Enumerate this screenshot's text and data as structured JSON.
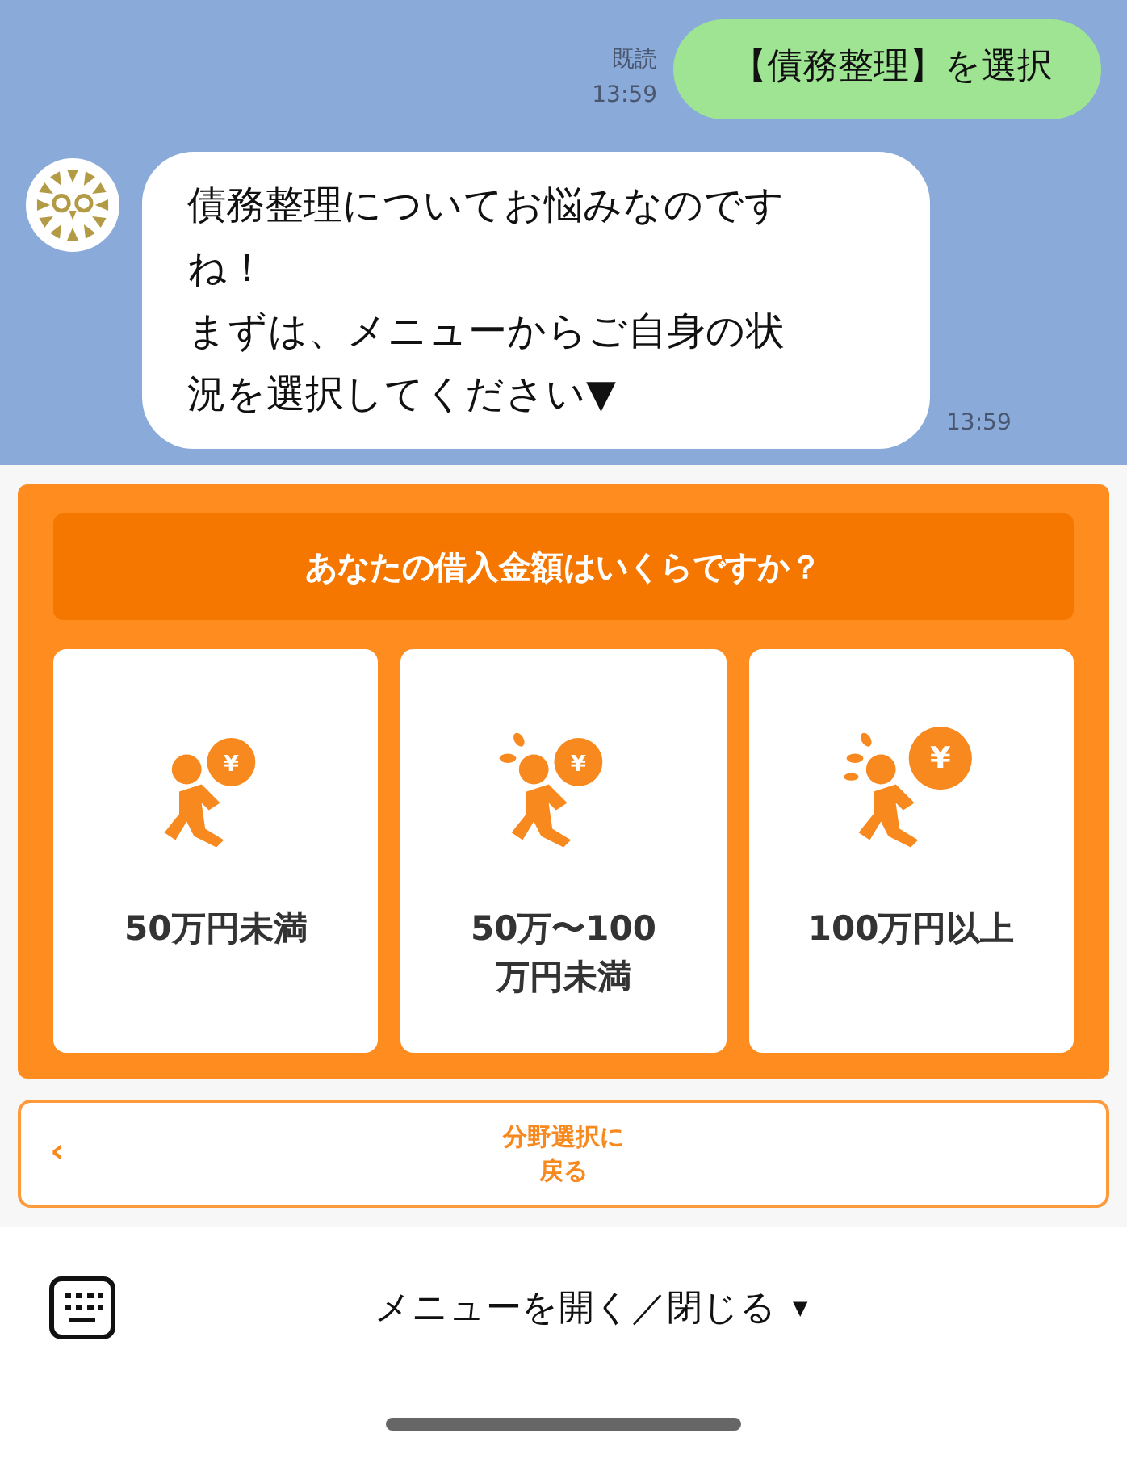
{
  "chat": {
    "messages": [
      {
        "kind": "outgoing",
        "text": "【債務整理】を選択",
        "read_label": "既読",
        "time": "13:59"
      },
      {
        "kind": "incoming",
        "paragraphs": [
          "債務整理についてお悩みなのですね！",
          "まずは、メニューからご自身の状況を選択してください▼"
        ],
        "time": "13:59"
      }
    ]
  },
  "rich_menu": {
    "question": "あなたの借入金額はいくらですか？",
    "options": [
      {
        "coin_symbol": "¥",
        "label": "50万円未満"
      },
      {
        "coin_symbol": "¥",
        "label": "50万〜100万円未満"
      },
      {
        "coin_symbol": "¥",
        "label": "100万円以上"
      }
    ],
    "back_button": {
      "icon": "‹",
      "label": "分野選択に戻る"
    }
  },
  "bottom_bar": {
    "menu_toggle": "メニューを開く／閉じる",
    "toggle_caret": "▼"
  }
}
